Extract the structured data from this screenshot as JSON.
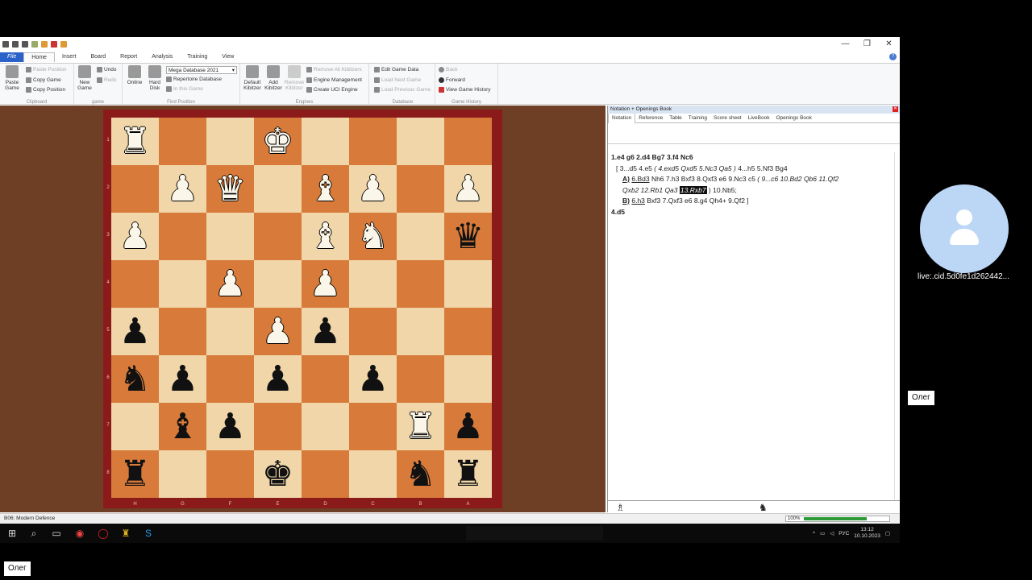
{
  "window": {
    "controls": [
      "—",
      "❐",
      "✕"
    ]
  },
  "menu": [
    "File",
    "Home",
    "Insert",
    "Board",
    "Report",
    "Analysis",
    "Training",
    "View"
  ],
  "ribbon": {
    "clipboard": {
      "paste_game": "Paste Game",
      "paste_position": "Paste Position",
      "copy_game": "Copy Game",
      "copy_position": "Copy Position",
      "group": "Clipboard"
    },
    "game": {
      "new_game": "New Game",
      "undo": "Undo",
      "redo": "Redo",
      "group": "game"
    },
    "find": {
      "online": "Online",
      "hard_disk": "Hard Disk",
      "database_select": "Mega Database 2021",
      "repertoire": "Repertoire Database",
      "in_this_game": "In this Game",
      "group": "Find Position"
    },
    "engines": {
      "default_kibitzer": "Default Kibitzer",
      "add_kibitzer": "Add Kibitzer",
      "remove_kibitzer": "Remove Kibitzer",
      "remove_all": "Remove All Kibitzers",
      "engine_mgmt": "Engine Management",
      "create_uci": "Create UCI Engine",
      "group": "Engines"
    },
    "database": {
      "edit_game_data": "Edit Game Data",
      "load_next": "Load Next Game",
      "load_prev": "Load Previous Game",
      "group": "Database"
    },
    "history": {
      "back": "Back",
      "forward": "Forward",
      "view_history": "View Game History",
      "group": "Game History"
    }
  },
  "board": {
    "ranks": [
      "1",
      "2",
      "3",
      "4",
      "5",
      "6",
      "7",
      "8"
    ],
    "files": [
      "H",
      "G",
      "F",
      "E",
      "D",
      "C",
      "B",
      "A"
    ],
    "rows": [
      [
        "wR",
        "",
        "",
        "wK",
        "",
        "",
        "",
        ""
      ],
      [
        "",
        "wP",
        "wQ",
        "",
        "wB",
        "wP",
        "",
        "wP"
      ],
      [
        "wP",
        "",
        "",
        "",
        "wB",
        "wN",
        "",
        "bQ"
      ],
      [
        "",
        "",
        "wP",
        "",
        "wP",
        "",
        "",
        ""
      ],
      [
        "bP",
        "",
        "",
        "wP",
        "bP",
        "",
        "",
        ""
      ],
      [
        "bN",
        "bP",
        "",
        "bP",
        "",
        "bP",
        "",
        ""
      ],
      [
        "",
        "bB",
        "bP",
        "",
        "",
        "",
        "wR",
        "bP"
      ],
      [
        "bR",
        "",
        "",
        "bK",
        "",
        "",
        "bN",
        "bR"
      ]
    ]
  },
  "notation": {
    "header": "Notation + Openings Book",
    "tabs": [
      "Notation",
      "Reference",
      "Table",
      "Training",
      "Score sheet",
      "LiveBook",
      "Openings Book"
    ],
    "main_line": "1.e4  g6  2.d4  Bg7  3.f4  Nc6",
    "var_a": "[ 3...d5  4.e5  ",
    "var_a_it": "( 4.exd5  Qxd5  5.Nc3  Qa5 )",
    "var_a_rest": " 4...h5  5.Nf3  Bg4",
    "sub_a_label": "A)",
    "sub_a_move": "6.Bd3",
    "sub_a_text": "  Nh6  7.h3  Bxf3  8.Qxf3  e6  9.Nc3  c5  ",
    "sub_a_it": "( 9...c6  10.Bd2  Qb6  11.Qf2",
    "sub_a_it2": "Qxb2  12.Rb1  Qa3 ",
    "sub_a_hl": "13.Rxb7",
    "sub_a_end": " )  10.Nb5;",
    "sub_b_label": "B)",
    "sub_b_move": "6.h3",
    "sub_b_text": "  Bxf3  7.Qxf3  e6  8.g4  Qh4+  9.Qf2 ]",
    "current_move": "4.d5",
    "footer_white": "♗",
    "footer_black": "♞"
  },
  "status": {
    "opening": "B06: Modern Defence",
    "zoom": "100%",
    "progress": 0.78
  },
  "taskbar": {
    "lang": "РУС",
    "time": "13:12",
    "date": "10.10.2023"
  },
  "meeting": {
    "participant_id": "live:.cid.5d0fe1d262442...",
    "name1": "Олег",
    "name2": "Олег"
  }
}
